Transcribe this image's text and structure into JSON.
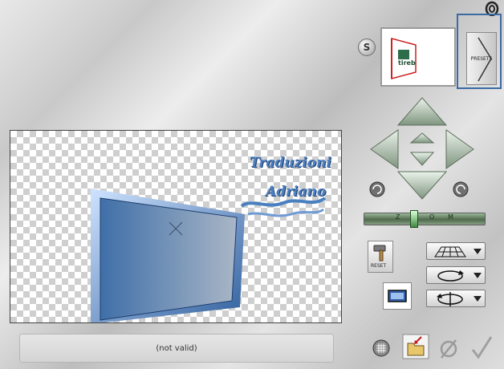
{
  "header": {
    "s_badge_label": "S",
    "presets_label": "PRESETS"
  },
  "thumbnail": {
    "preview_text": "tireb"
  },
  "preview": {
    "watermark_line1": "Traduzioni",
    "watermark_line2": "Adriano"
  },
  "controls": {
    "reset_label": "RESET",
    "zoom": {
      "labels": [
        "Z",
        "O",
        "M"
      ],
      "level": 0.4
    }
  },
  "status": {
    "text": "(not valid)"
  },
  "colors": {
    "accent_frame": "#3c6aa4",
    "arrow_green": "#a8b8a8",
    "preview_frame_blue": "#4c7fbf"
  },
  "icons": {
    "corner": "paperclip-icon",
    "grid": "grid-icon",
    "load": "folder-load-icon",
    "cancel": "cancel-icon",
    "ok": "checkmark-icon"
  }
}
